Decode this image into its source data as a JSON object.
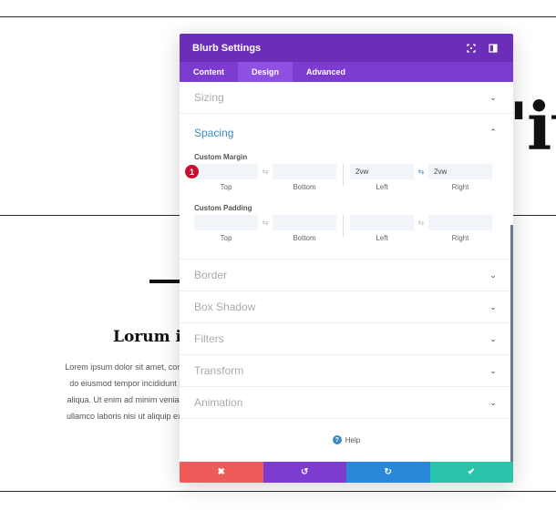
{
  "page": {
    "big_title_fragment": "'it",
    "blurb_title": "Lorum ip",
    "blurb_lines": [
      "Lorem ipsum dolor sit amet, conse",
      "do eiusmod tempor incididunt ut",
      "aliqua. Ut enim ad minim veniam,",
      "ullamco laboris nisi ut aliquip ex e"
    ]
  },
  "modal": {
    "title": "Blurb Settings",
    "tabs": [
      {
        "label": "Content",
        "active": false
      },
      {
        "label": "Design",
        "active": true
      },
      {
        "label": "Advanced",
        "active": false
      }
    ],
    "sections_top": [
      "Sizing"
    ],
    "spacing": {
      "label": "Spacing",
      "badge": "1",
      "margin": {
        "label": "Custom Margin",
        "top": "",
        "bottom": "",
        "left": "2vw",
        "right": "2vw",
        "captions": [
          "Top",
          "Bottom",
          "Left",
          "Right"
        ]
      },
      "padding": {
        "label": "Custom Padding",
        "top": "",
        "bottom": "",
        "left": "",
        "right": "",
        "captions": [
          "Top",
          "Bottom",
          "Left",
          "Right"
        ]
      }
    },
    "sections_bottom": [
      "Border",
      "Box Shadow",
      "Filters",
      "Transform",
      "Animation"
    ],
    "help_label": "Help",
    "footer": {
      "cancel": "✖",
      "undo": "↺",
      "redo": "↻",
      "save": "✔"
    }
  },
  "colors": {
    "header": "#6c2eb9",
    "tabs": "#7e3bd0",
    "accent": "#3c8bbf",
    "cancel": "#ef5a5a",
    "undo": "#7e3bd0",
    "redo": "#2b87da",
    "save": "#29c4a9"
  }
}
